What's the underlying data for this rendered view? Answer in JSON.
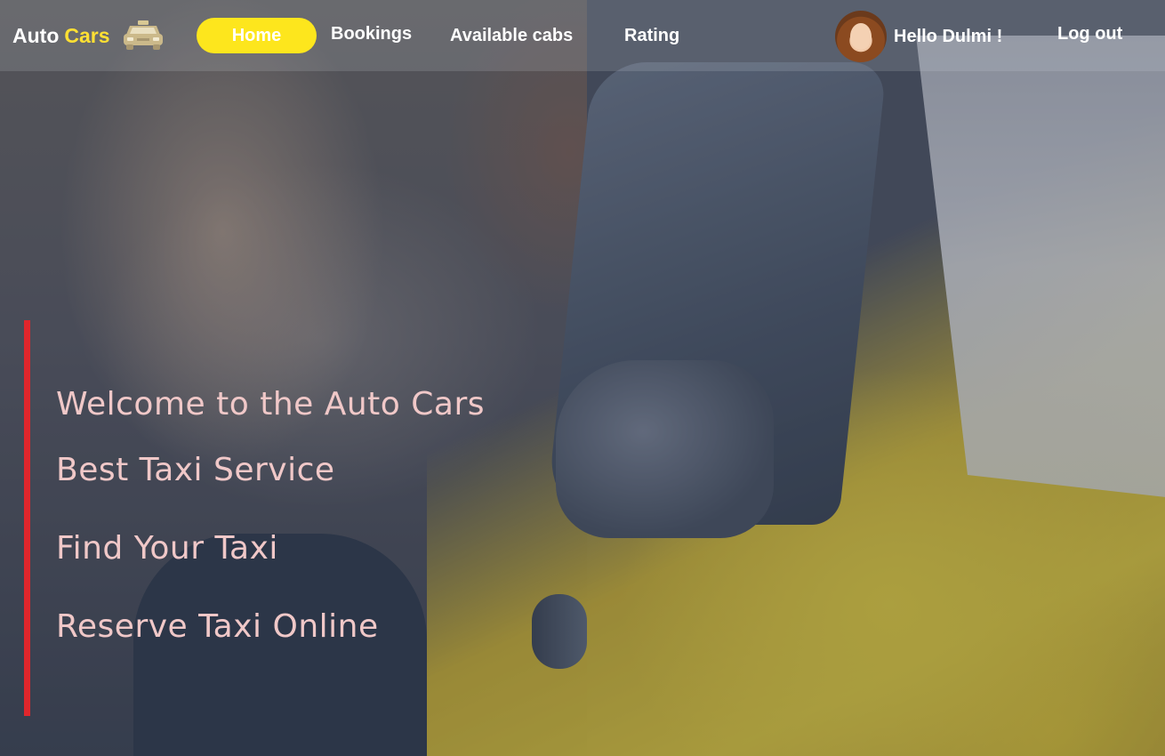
{
  "brand": {
    "name_part1": "Auto",
    "name_part2": "Cars",
    "icon": "taxi-icon",
    "accent_color": "#ffe033"
  },
  "nav": {
    "home": "Home",
    "bookings": "Bookings",
    "available_cabs": "Available cabs",
    "rating": "Rating",
    "logout": "Log out",
    "active_color": "#fde61d"
  },
  "user": {
    "greeting": "Hello Dulmi !",
    "avatar": "user-avatar"
  },
  "hero": {
    "line1": "Welcome to the Auto Cars",
    "line2": "Best Taxi Service",
    "line3": "Find Your Taxi",
    "line4": "Reserve  Taxi Online",
    "bar_color": "#e0262c",
    "text_color": "#f0c8c8"
  }
}
